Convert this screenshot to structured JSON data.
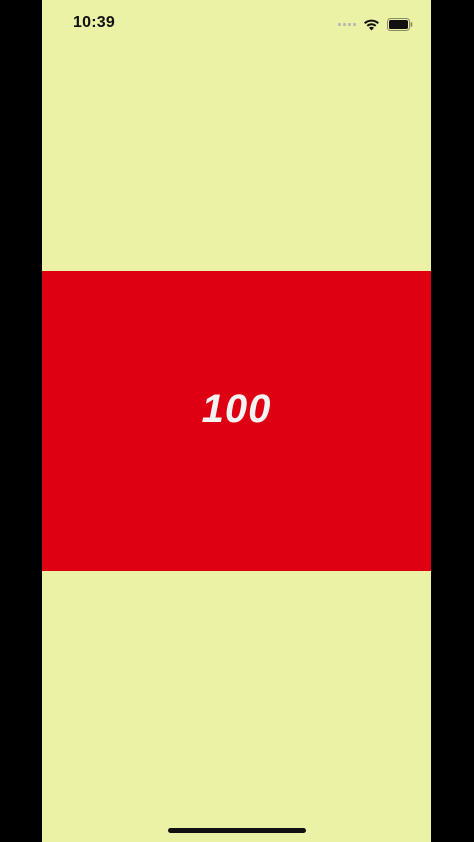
{
  "status_bar": {
    "time": "10:39",
    "icons": [
      "cellular-signal-icon",
      "wifi-icon",
      "battery-icon"
    ]
  },
  "main": {
    "value": "100"
  },
  "colors": {
    "background": "#ebf1a5",
    "banner": "#de0012",
    "value_text": "#f3f3f3"
  }
}
